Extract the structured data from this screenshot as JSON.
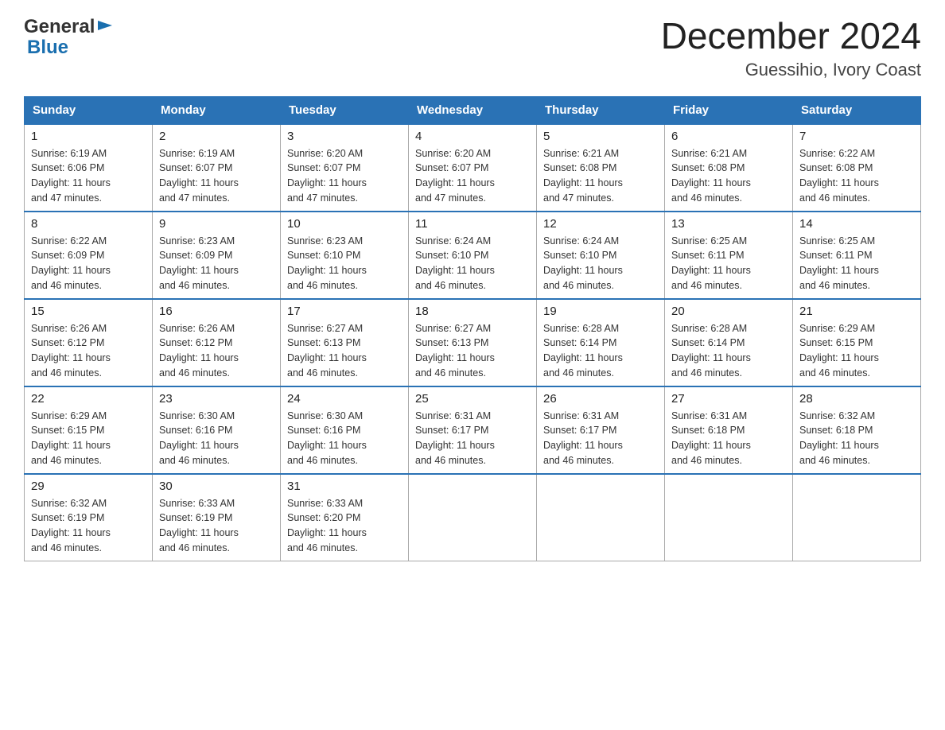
{
  "header": {
    "title": "December 2024",
    "subtitle": "Guessihio, Ivory Coast"
  },
  "days_of_week": [
    "Sunday",
    "Monday",
    "Tuesday",
    "Wednesday",
    "Thursday",
    "Friday",
    "Saturday"
  ],
  "weeks": [
    [
      {
        "day": "1",
        "sunrise": "6:19 AM",
        "sunset": "6:06 PM",
        "daylight": "11 hours and 47 minutes."
      },
      {
        "day": "2",
        "sunrise": "6:19 AM",
        "sunset": "6:07 PM",
        "daylight": "11 hours and 47 minutes."
      },
      {
        "day": "3",
        "sunrise": "6:20 AM",
        "sunset": "6:07 PM",
        "daylight": "11 hours and 47 minutes."
      },
      {
        "day": "4",
        "sunrise": "6:20 AM",
        "sunset": "6:07 PM",
        "daylight": "11 hours and 47 minutes."
      },
      {
        "day": "5",
        "sunrise": "6:21 AM",
        "sunset": "6:08 PM",
        "daylight": "11 hours and 47 minutes."
      },
      {
        "day": "6",
        "sunrise": "6:21 AM",
        "sunset": "6:08 PM",
        "daylight": "11 hours and 46 minutes."
      },
      {
        "day": "7",
        "sunrise": "6:22 AM",
        "sunset": "6:08 PM",
        "daylight": "11 hours and 46 minutes."
      }
    ],
    [
      {
        "day": "8",
        "sunrise": "6:22 AM",
        "sunset": "6:09 PM",
        "daylight": "11 hours and 46 minutes."
      },
      {
        "day": "9",
        "sunrise": "6:23 AM",
        "sunset": "6:09 PM",
        "daylight": "11 hours and 46 minutes."
      },
      {
        "day": "10",
        "sunrise": "6:23 AM",
        "sunset": "6:10 PM",
        "daylight": "11 hours and 46 minutes."
      },
      {
        "day": "11",
        "sunrise": "6:24 AM",
        "sunset": "6:10 PM",
        "daylight": "11 hours and 46 minutes."
      },
      {
        "day": "12",
        "sunrise": "6:24 AM",
        "sunset": "6:10 PM",
        "daylight": "11 hours and 46 minutes."
      },
      {
        "day": "13",
        "sunrise": "6:25 AM",
        "sunset": "6:11 PM",
        "daylight": "11 hours and 46 minutes."
      },
      {
        "day": "14",
        "sunrise": "6:25 AM",
        "sunset": "6:11 PM",
        "daylight": "11 hours and 46 minutes."
      }
    ],
    [
      {
        "day": "15",
        "sunrise": "6:26 AM",
        "sunset": "6:12 PM",
        "daylight": "11 hours and 46 minutes."
      },
      {
        "day": "16",
        "sunrise": "6:26 AM",
        "sunset": "6:12 PM",
        "daylight": "11 hours and 46 minutes."
      },
      {
        "day": "17",
        "sunrise": "6:27 AM",
        "sunset": "6:13 PM",
        "daylight": "11 hours and 46 minutes."
      },
      {
        "day": "18",
        "sunrise": "6:27 AM",
        "sunset": "6:13 PM",
        "daylight": "11 hours and 46 minutes."
      },
      {
        "day": "19",
        "sunrise": "6:28 AM",
        "sunset": "6:14 PM",
        "daylight": "11 hours and 46 minutes."
      },
      {
        "day": "20",
        "sunrise": "6:28 AM",
        "sunset": "6:14 PM",
        "daylight": "11 hours and 46 minutes."
      },
      {
        "day": "21",
        "sunrise": "6:29 AM",
        "sunset": "6:15 PM",
        "daylight": "11 hours and 46 minutes."
      }
    ],
    [
      {
        "day": "22",
        "sunrise": "6:29 AM",
        "sunset": "6:15 PM",
        "daylight": "11 hours and 46 minutes."
      },
      {
        "day": "23",
        "sunrise": "6:30 AM",
        "sunset": "6:16 PM",
        "daylight": "11 hours and 46 minutes."
      },
      {
        "day": "24",
        "sunrise": "6:30 AM",
        "sunset": "6:16 PM",
        "daylight": "11 hours and 46 minutes."
      },
      {
        "day": "25",
        "sunrise": "6:31 AM",
        "sunset": "6:17 PM",
        "daylight": "11 hours and 46 minutes."
      },
      {
        "day": "26",
        "sunrise": "6:31 AM",
        "sunset": "6:17 PM",
        "daylight": "11 hours and 46 minutes."
      },
      {
        "day": "27",
        "sunrise": "6:31 AM",
        "sunset": "6:18 PM",
        "daylight": "11 hours and 46 minutes."
      },
      {
        "day": "28",
        "sunrise": "6:32 AM",
        "sunset": "6:18 PM",
        "daylight": "11 hours and 46 minutes."
      }
    ],
    [
      {
        "day": "29",
        "sunrise": "6:32 AM",
        "sunset": "6:19 PM",
        "daylight": "11 hours and 46 minutes."
      },
      {
        "day": "30",
        "sunrise": "6:33 AM",
        "sunset": "6:19 PM",
        "daylight": "11 hours and 46 minutes."
      },
      {
        "day": "31",
        "sunrise": "6:33 AM",
        "sunset": "6:20 PM",
        "daylight": "11 hours and 46 minutes."
      },
      null,
      null,
      null,
      null
    ]
  ],
  "labels": {
    "sunrise": "Sunrise:",
    "sunset": "Sunset:",
    "daylight": "Daylight:"
  }
}
